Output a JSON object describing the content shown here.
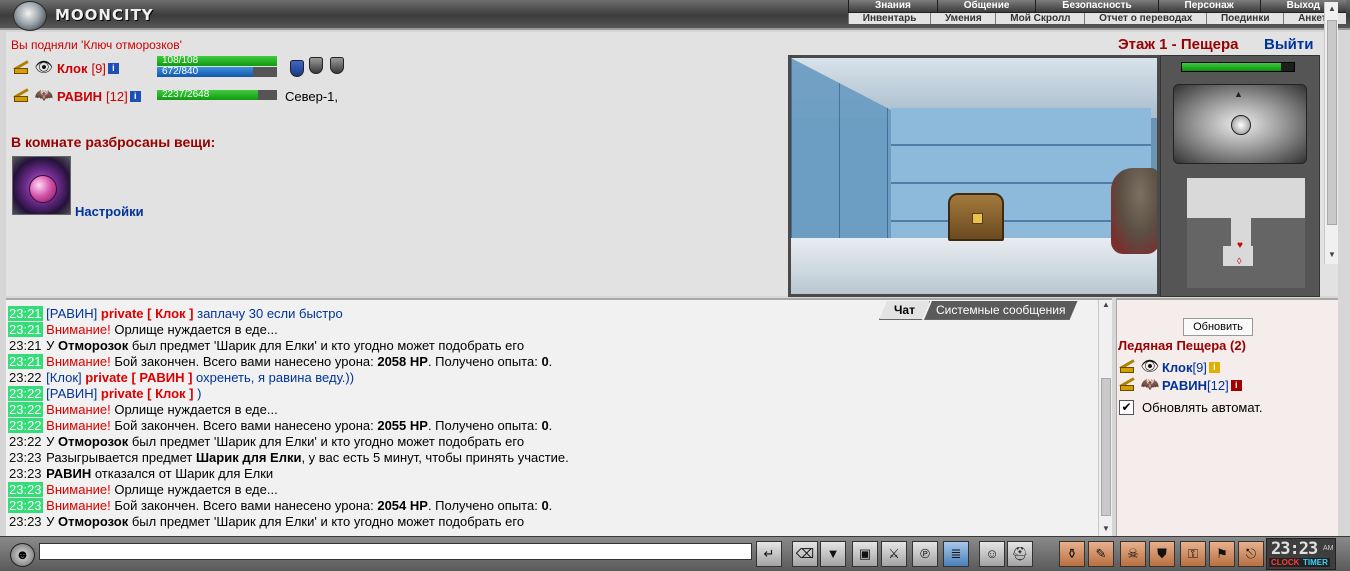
{
  "app": {
    "logo_text": "MOONCITY"
  },
  "top_menu": {
    "main": [
      "Знания",
      "Общение",
      "Безопасность",
      "Персонаж",
      "Выход"
    ],
    "sub": [
      "Инвентарь",
      "Умения",
      "Мой Скролл",
      "Отчет о переводах",
      "Поединки",
      "Анкета"
    ]
  },
  "notice": "Вы подняли 'Ключ отморозков'",
  "players": [
    {
      "name": "Клок",
      "level": "[9]",
      "hp": "108/108",
      "hp_fraction": 1.0,
      "mana": "672/840",
      "mana_fraction": 0.8
    },
    {
      "name": "РАВИН",
      "level": "[12]",
      "hp": "2237/2648",
      "hp_fraction": 0.845,
      "location": "Север-1,"
    }
  ],
  "items_title": "В комнате разбросаны вещи:",
  "settings_link": "Настройки",
  "location": {
    "floor_title": "Этаж 1 - Пещера",
    "exit_label": "Выйти"
  },
  "side_panel": {
    "hp_fraction": 0.88
  },
  "chat": {
    "tabs": [
      "Чат",
      "Системные сообщения"
    ],
    "lines": [
      {
        "time": "23:21",
        "hl": true,
        "parts": [
          {
            "c": "sp",
            "t": "[РАВИН]"
          },
          {
            "c": "pv",
            "t": " private [ Клок ] "
          },
          {
            "c": "pv-text",
            "t": "заплачу 30 если быстро"
          }
        ]
      },
      {
        "time": "23:21",
        "hl": true,
        "parts": [
          {
            "c": "warn",
            "t": "Внимание!"
          },
          {
            "c": "plain",
            "t": " Орлище нуждается в еде..."
          }
        ]
      },
      {
        "time": "23:21",
        "hl": false,
        "parts": [
          {
            "c": "plain",
            "t": "У "
          },
          {
            "c": "plain b",
            "t": "Отморозок"
          },
          {
            "c": "plain",
            "t": " был предмет 'Шарик для Елки' и кто угодно может подобрать его"
          }
        ]
      },
      {
        "time": "23:21",
        "hl": true,
        "parts": [
          {
            "c": "warn",
            "t": "Внимание!"
          },
          {
            "c": "plain",
            "t": " Бой закончен. Всего вами нанесено урона: "
          },
          {
            "c": "plain b",
            "t": "2058 HP"
          },
          {
            "c": "plain",
            "t": ". Получено опыта: "
          },
          {
            "c": "plain b",
            "t": "0"
          },
          {
            "c": "plain",
            "t": "."
          }
        ]
      },
      {
        "time": "23:22",
        "hl": false,
        "parts": [
          {
            "c": "sp",
            "t": "[Клок]"
          },
          {
            "c": "pv",
            "t": " private [ РАВИН ] "
          },
          {
            "c": "pv-text",
            "t": "охренеть, я равина веду.))"
          }
        ]
      },
      {
        "time": "23:22",
        "hl": true,
        "parts": [
          {
            "c": "sp",
            "t": "[РАВИН]"
          },
          {
            "c": "pv",
            "t": " private [ Клок ] "
          },
          {
            "c": "pv-text",
            "t": ")"
          }
        ]
      },
      {
        "time": "23:22",
        "hl": true,
        "parts": [
          {
            "c": "warn",
            "t": "Внимание!"
          },
          {
            "c": "plain",
            "t": " Орлище нуждается в еде..."
          }
        ]
      },
      {
        "time": "23:22",
        "hl": true,
        "parts": [
          {
            "c": "warn",
            "t": "Внимание!"
          },
          {
            "c": "plain",
            "t": " Бой закончен. Всего вами нанесено урона: "
          },
          {
            "c": "plain b",
            "t": "2055 HP"
          },
          {
            "c": "plain",
            "t": ". Получено опыта: "
          },
          {
            "c": "plain b",
            "t": "0"
          },
          {
            "c": "plain",
            "t": "."
          }
        ]
      },
      {
        "time": "23:22",
        "hl": false,
        "parts": [
          {
            "c": "plain",
            "t": "У "
          },
          {
            "c": "plain b",
            "t": "Отморозок"
          },
          {
            "c": "plain",
            "t": " был предмет 'Шарик для Елки' и кто угодно может подобрать его"
          }
        ]
      },
      {
        "time": "23:23",
        "hl": false,
        "parts": [
          {
            "c": "plain",
            "t": "Разыгрывается предмет "
          },
          {
            "c": "plain b",
            "t": "Шарик для Елки"
          },
          {
            "c": "plain",
            "t": ", у вас есть 5 минут, чтобы принять участие."
          }
        ]
      },
      {
        "time": "23:23",
        "hl": false,
        "parts": [
          {
            "c": "plain b",
            "t": "РАВИН"
          },
          {
            "c": "plain",
            "t": " отказался от Шарик для Елки"
          }
        ]
      },
      {
        "time": "23:23",
        "hl": true,
        "parts": [
          {
            "c": "warn",
            "t": "Внимание!"
          },
          {
            "c": "plain",
            "t": " Орлище нуждается в еде..."
          }
        ]
      },
      {
        "time": "23:23",
        "hl": true,
        "parts": [
          {
            "c": "warn",
            "t": "Внимание!"
          },
          {
            "c": "plain",
            "t": " Бой закончен. Всего вами нанесено урона: "
          },
          {
            "c": "plain b",
            "t": "2054 HP"
          },
          {
            "c": "plain",
            "t": ". Получено опыта: "
          },
          {
            "c": "plain b",
            "t": "0"
          },
          {
            "c": "plain",
            "t": "."
          }
        ]
      },
      {
        "time": "23:23",
        "hl": false,
        "parts": [
          {
            "c": "plain",
            "t": "У "
          },
          {
            "c": "plain b",
            "t": "Отморозок"
          },
          {
            "c": "plain",
            "t": " был предмет 'Шарик для Елки' и кто угодно может подобрать его"
          }
        ]
      }
    ]
  },
  "room_panel": {
    "refresh_label": "Обновить",
    "title": "Ледяная Пещера (2)",
    "users": [
      {
        "name": "Клок",
        "level": "[9]",
        "info_color": "#e0b000"
      },
      {
        "name": "РАВИН",
        "level": "[12]",
        "info_color": "#a00000"
      }
    ],
    "auto_refresh_label": "Обновлять автомат.",
    "auto_refresh_checked": true
  },
  "bottom_bar": {
    "chat_input_value": "",
    "clock": {
      "time": "23:23",
      "ampm": "AM",
      "clock_label": "CLOCK",
      "timer_label": "TIMER"
    }
  },
  "colors": {
    "accent_red": "#990000",
    "link_blue": "#003399",
    "timestamp_highlight": "#33dd77",
    "hp_green": "#119911",
    "mana_blue": "#1257a8"
  }
}
